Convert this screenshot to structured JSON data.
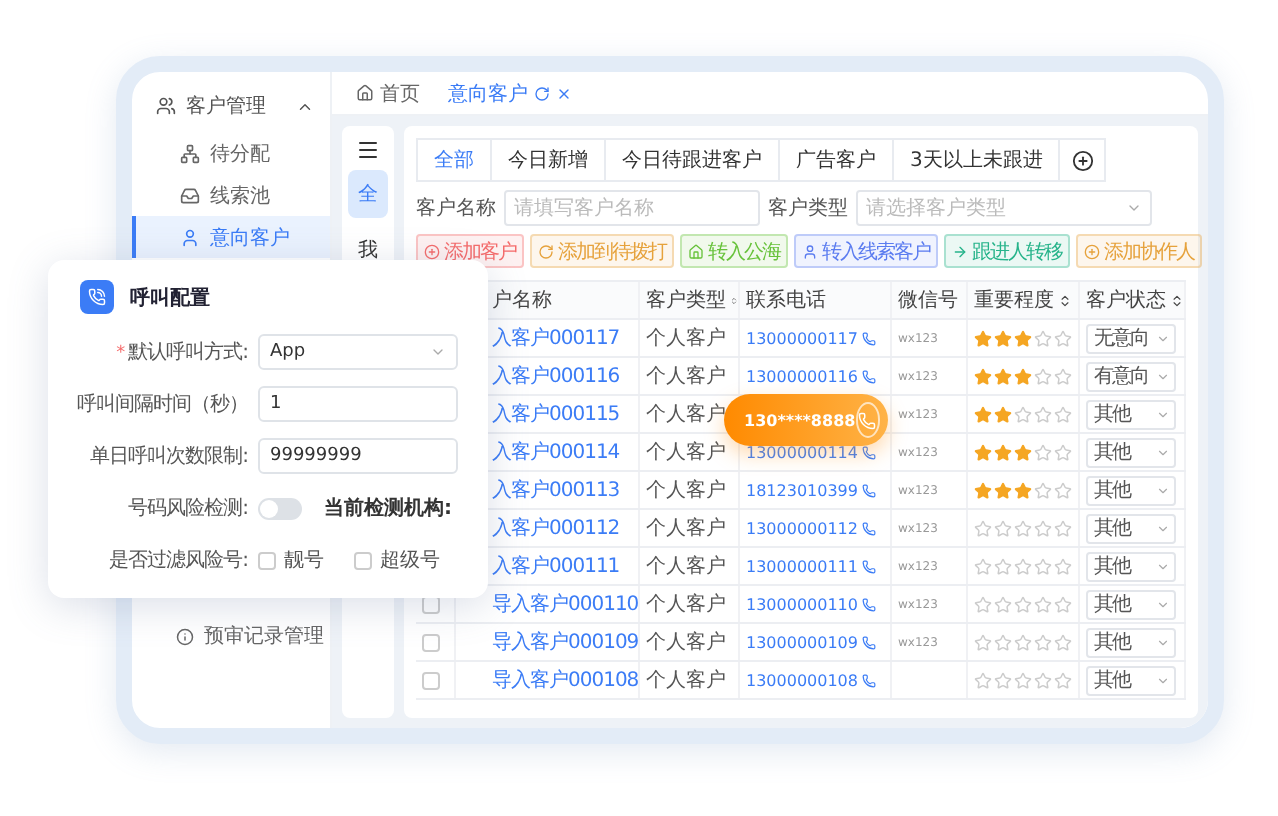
{
  "sidebar": {
    "group": {
      "label": "客户管理",
      "expanded": true
    },
    "items": [
      {
        "label": "待分配",
        "selected": false
      },
      {
        "label": "线索池",
        "selected": false
      },
      {
        "label": "意向客户",
        "selected": true
      }
    ],
    "bottom_item": {
      "label": "预审记录管理"
    }
  },
  "breadcrumb": [
    {
      "label": "首页",
      "selected": false
    },
    {
      "label": "意向客户",
      "selected": true
    }
  ],
  "scope_tabs": [
    {
      "label": "全",
      "selected": true
    },
    {
      "label": "我",
      "selected": false
    }
  ],
  "tabs": [
    {
      "label": "全部",
      "selected": true
    },
    {
      "label": "今日新增",
      "selected": false
    },
    {
      "label": "今日待跟进客户",
      "selected": false
    },
    {
      "label": "广告客户",
      "selected": false
    },
    {
      "label": "3天以上未跟进",
      "selected": false
    }
  ],
  "filters": {
    "name_label": "客户名称",
    "name_placeholder": "请填写客户名称",
    "type_label": "客户类型",
    "type_placeholder": "请选择客户类型"
  },
  "actions": [
    {
      "label": "添加客户",
      "color": "#f56c6c"
    },
    {
      "label": "添加到待拨打",
      "color": "#e6a23c"
    },
    {
      "label": "转入公海",
      "color": "#67c23a"
    },
    {
      "label": "转入线索客户",
      "color": "#5b7cf0"
    },
    {
      "label": "跟进人转移",
      "color": "#26b38a"
    },
    {
      "label": "添加协作人",
      "color": "#e6a23c"
    }
  ],
  "table": {
    "columns": [
      {
        "label": "户名称",
        "sortable": false
      },
      {
        "label": "客户类型",
        "sortable": true
      },
      {
        "label": "联系电话",
        "sortable": false
      },
      {
        "label": "微信号",
        "sortable": false
      },
      {
        "label": "重要程度",
        "sortable": true
      },
      {
        "label": "客户状态",
        "sortable": true
      }
    ],
    "rows": [
      {
        "name": "入客户000117",
        "type": "个人客户",
        "phone": "13000000117",
        "wechat": "wx123",
        "stars": 3,
        "status": "无意向"
      },
      {
        "name": "入客户000116",
        "type": "个人客户",
        "phone": "13000000116",
        "wechat": "wx123",
        "stars": 3,
        "status": "有意向"
      },
      {
        "name": "入客户000115",
        "type": "个人客户",
        "wechat": "wx123",
        "stars": 2,
        "status": "其他"
      },
      {
        "name": "入客户000114",
        "type": "个人客户",
        "phone": "13000000114",
        "wechat": "wx123",
        "stars": 3,
        "status": "其他"
      },
      {
        "name": "入客户000113",
        "type": "个人客户",
        "phone": "18123010399",
        "wechat": "wx123",
        "stars": 3,
        "status": "其他"
      },
      {
        "name": "入客户000112",
        "type": "个人客户",
        "phone": "13000000112",
        "wechat": "wx123",
        "stars": 0,
        "status": "其他"
      },
      {
        "name": "入客户000111",
        "type": "个人客户",
        "phone": "13000000111",
        "wechat": "wx123",
        "stars": 0,
        "status": "其他"
      },
      {
        "name": "导入客户000110",
        "type": "个人客户",
        "phone": "13000000110",
        "wechat": "wx123",
        "stars": 0,
        "status": "其他",
        "checked": false
      },
      {
        "name": "导入客户000109",
        "type": "个人客户",
        "phone": "13000000109",
        "wechat": "wx123",
        "stars": 0,
        "status": "其他",
        "checked": false
      },
      {
        "name": "导入客户000108",
        "type": "个人客户",
        "phone": "13000000108",
        "stars": 0,
        "status": "其他",
        "checked": false
      }
    ]
  },
  "call_dialog": {
    "title": "呼叫配置",
    "fields": [
      {
        "kind": "select",
        "required_mark": "*",
        "label": "默认呼叫方式:",
        "value": "App"
      },
      {
        "kind": "input",
        "label": "呼叫间隔时间（秒）",
        "value": "1"
      },
      {
        "kind": "input",
        "label": "单日呼叫次数限制:",
        "value": "99999999"
      },
      {
        "kind": "switch",
        "label": "号码风险检测:",
        "on": false,
        "note": "当前检测机构:"
      },
      {
        "kind": "checks",
        "label": "是否过滤风险号:",
        "options": [
          {
            "label": "靓号",
            "checked": false
          },
          {
            "label": "超级号",
            "checked": false
          }
        ]
      }
    ]
  },
  "call_pill": {
    "number": "130****8888"
  }
}
